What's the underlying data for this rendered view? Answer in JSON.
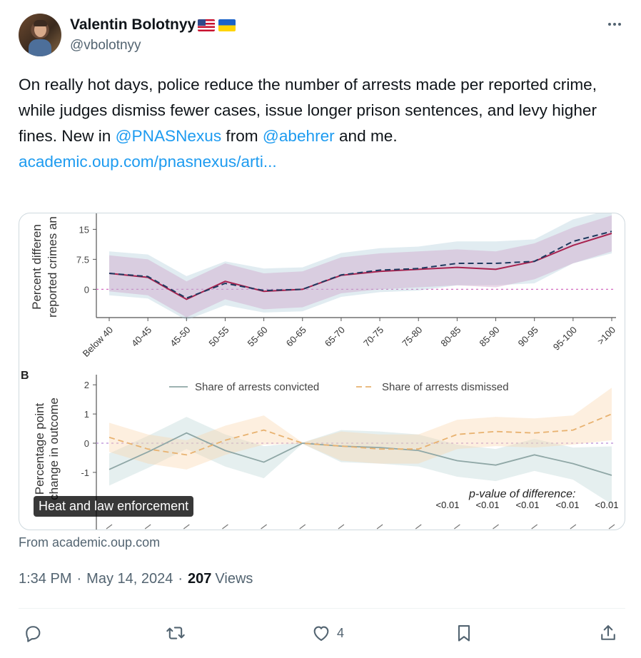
{
  "author": {
    "name": "Valentin Bolotnyy",
    "handle": "@vbolotnyy",
    "flags": [
      "us-flag",
      "ukraine-flag"
    ]
  },
  "tweet": {
    "text_before_1": "On really hot days, police reduce the number of arrests made per reported crime, while judges dismiss fewer cases, issue longer prison sentences, and levy higher fines. New in ",
    "mention_1": "@PNASNexus",
    "text_middle": " from ",
    "mention_2": "@abehrer",
    "text_after": " and me.",
    "link": "academic.oup.com/pnasnexus/arti..."
  },
  "card": {
    "label": "Heat and law enforcement",
    "source": "From academic.oup.com"
  },
  "meta": {
    "time": "1:34 PM",
    "date": "May 14, 2024",
    "views_count": "207",
    "views_label": "Views"
  },
  "actions": {
    "reply_count": "",
    "repost_count": "",
    "like_count": "4"
  },
  "colors": {
    "link": "#1d9bf0",
    "text": "#0f1419",
    "muted": "#536471"
  },
  "chart_data": [
    {
      "type": "line",
      "panel": "A",
      "ylabel": "Percent differen reported crimes an",
      "y_ticks": [
        "15",
        "7.5",
        "0"
      ],
      "ylim": [
        -6,
        19
      ],
      "categories": [
        "Below 40",
        "40-45",
        "45-50",
        "50-55",
        "55-60",
        "60-65",
        "65-70",
        "70-75",
        "75-80",
        "80-85",
        "85-90",
        "90-95",
        "95-100",
        ">100"
      ],
      "series": [
        {
          "style": "solid",
          "values": [
            4,
            3,
            -2.5,
            2,
            -0.5,
            0,
            3.5,
            4.5,
            5,
            5.5,
            5,
            7,
            11,
            14
          ]
        },
        {
          "style": "dashed",
          "values": [
            4,
            3.2,
            -2.2,
            1.5,
            -0.3,
            0,
            3.6,
            4.8,
            5.2,
            6.5,
            6.5,
            7,
            12,
            14.5
          ]
        }
      ]
    },
    {
      "type": "line",
      "panel": "B",
      "panel_label": "B",
      "ylabel": "Percentage point change in outcome",
      "y_ticks": [
        "2",
        "1",
        "0",
        "-1"
      ],
      "ylim": [
        -2.2,
        2.2
      ],
      "series": [
        {
          "name": "Share of arrests convicted",
          "style": "solid",
          "values": [
            -0.9,
            -0.3,
            0.35,
            -0.25,
            -0.65,
            0,
            -0.1,
            -0.15,
            -0.25,
            -0.6,
            -0.75,
            -0.4,
            -0.7,
            -1.1
          ]
        },
        {
          "name": "Share of arrests dismissed",
          "style": "dashed",
          "values": [
            0.2,
            -0.2,
            -0.4,
            0.1,
            0.45,
            0,
            -0.1,
            -0.2,
            -0.2,
            0.3,
            0.4,
            0.35,
            0.45,
            1.0
          ]
        }
      ],
      "annotation": "p-value of difference:",
      "p_values": [
        "<0.01",
        "<0.01",
        "<0.01",
        "<0.01",
        "<0.01"
      ]
    }
  ]
}
